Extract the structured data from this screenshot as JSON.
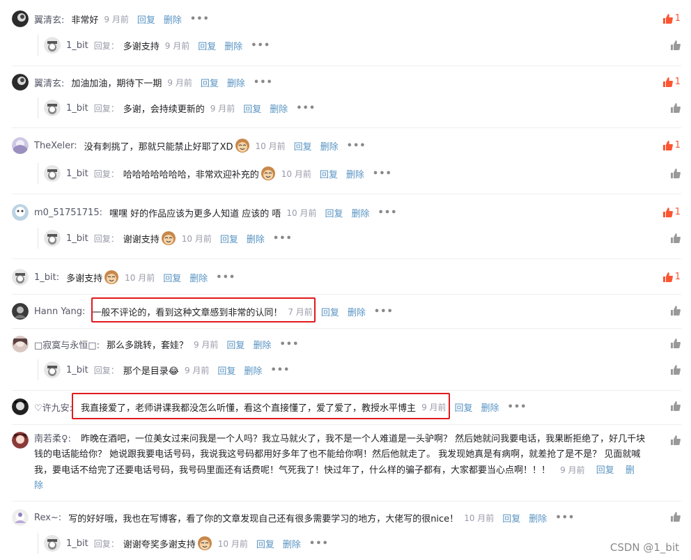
{
  "colors": {
    "link": "#5893c2",
    "like": "#fc5531",
    "highlight": "#e0191e"
  },
  "labels": {
    "reply": "回复",
    "delete": "删除",
    "reply_tag": "回复：",
    "more": "•••"
  },
  "comments": [
    {
      "user": "翼清玄:",
      "content": "非常好",
      "time": "9 月前",
      "likes": "1",
      "reply": {
        "user": "1_bit",
        "content": "多谢支持",
        "time": "9 月前"
      }
    },
    {
      "user": "翼清玄:",
      "content": "加油加油，期待下一期",
      "time": "9 月前",
      "likes": "1",
      "reply": {
        "user": "1_bit",
        "content": "多谢，会持续更新的",
        "time": "9 月前"
      }
    },
    {
      "user": "TheXeler:",
      "content": "没有刺挑了，那就只能禁止好耶了XD",
      "time": "10 月前",
      "likes": "1",
      "reply": {
        "user": "1_bit",
        "content": "哈哈哈哈哈哈哈，非常欢迎补充的",
        "time": "10 月前"
      }
    },
    {
      "user": "m0_51751715:",
      "content": "嘿嘿 好的作品应该为更多人知道 应该的 唔",
      "time": "10 月前",
      "likes": "1",
      "reply": {
        "user": "1_bit",
        "content": "谢谢支持",
        "time": "10 月前"
      }
    },
    {
      "user": "1_bit:",
      "content": "多谢支持",
      "time": "10 月前",
      "likes": "1"
    },
    {
      "user": "Hann Yang:",
      "content": "一般不评论的，看到这种文章感到非常的认同！",
      "time": "7 月前"
    },
    {
      "user": "□寂寞与永恒□:",
      "content": "那么多跳转，套娃？",
      "time": "9 月前",
      "reply": {
        "user": "1_bit",
        "content": "那个是目录😂",
        "time": "9 月前"
      }
    },
    {
      "user": "♡许九安:",
      "content": "我直接爱了，老师讲课我都没怎么听懂，看这个直接懂了，爱了爱了，教授水平博主",
      "time": "9 月前"
    },
    {
      "user": "南若柔♀:",
      "content": "昨晚在酒吧，一位美女过来问我是一个人吗？我立马就火了，我不是一个人难道是一头驴啊？ 然后她就问我要电话，我果断拒绝了，好几千块钱的电话能给你？ 她说跟我要电话号码，我说我这号码都用好多年了也不能给你啊！然后他就走了。 我发现她真是有病啊，就差抢了是不是？ 见面就喊我，要电话不给完了还要电话号码，我号码里面还有话费呢！气死我了！快过年了，什么样的骗子都有，大家都要当心点啊！！！",
      "time": "9 月前"
    },
    {
      "user": "Rex~:",
      "content": "写的好好哦，我也在写博客，看了你的文章发现自己还有很多需要学习的地方，大佬写的很nice！",
      "time": "10 月前",
      "reply": {
        "user": "1_bit",
        "content": "谢谢夸奖多谢支持",
        "time": "10 月前"
      }
    }
  ],
  "watermark": "CSDN @1_bit"
}
